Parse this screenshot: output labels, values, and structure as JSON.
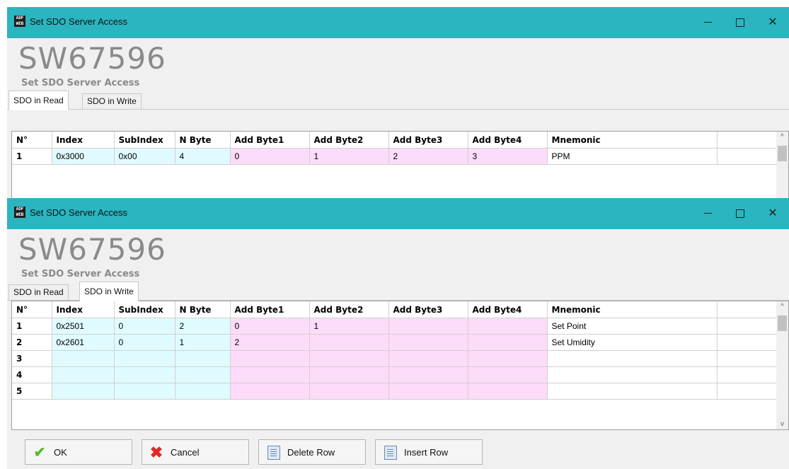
{
  "icon_name": "app-logo-icon",
  "colors": {
    "titlebar": "#2ab5c0",
    "index_cols": "#e0fbff",
    "addbyte_cols": "#fcdcf8"
  },
  "windows": [
    {
      "title": "Set SDO Server Access",
      "code": "SW67596",
      "subtitle": "Set SDO Server Access",
      "tabs": [
        "SDO in Read",
        "SDO in Write"
      ],
      "active_tab": 0,
      "columns": [
        "N°",
        "Index",
        "SubIndex",
        "N Byte",
        "Add Byte1",
        "Add Byte2",
        "Add Byte3",
        "Add Byte4",
        "Mnemonic"
      ],
      "rows": [
        {
          "n": "1",
          "index": "0x3000",
          "subindex": "0x00",
          "nbyte": "4",
          "b1": "0",
          "b2": "1",
          "b3": "2",
          "b4": "3",
          "mnemonic": "PPM"
        }
      ]
    },
    {
      "title": "Set SDO Server Access",
      "code": "SW67596",
      "subtitle": "Set SDO Server Access",
      "tabs": [
        "SDO in Read",
        "SDO in Write"
      ],
      "active_tab": 1,
      "columns": [
        "N°",
        "Index",
        "SubIndex",
        "N Byte",
        "Add Byte1",
        "Add Byte2",
        "Add Byte3",
        "Add Byte4",
        "Mnemonic"
      ],
      "rows": [
        {
          "n": "1",
          "index": "0x2501",
          "subindex": "0",
          "nbyte": "2",
          "b1": "0",
          "b2": "1",
          "b3": "",
          "b4": "",
          "mnemonic": "Set Point"
        },
        {
          "n": "2",
          "index": "0x2601",
          "subindex": "0",
          "nbyte": "1",
          "b1": "2",
          "b2": "",
          "b3": "",
          "b4": "",
          "mnemonic": "Set Umidity"
        },
        {
          "n": "3",
          "index": "",
          "subindex": "",
          "nbyte": "",
          "b1": "",
          "b2": "",
          "b3": "",
          "b4": "",
          "mnemonic": ""
        },
        {
          "n": "4",
          "index": "",
          "subindex": "",
          "nbyte": "",
          "b1": "",
          "b2": "",
          "b3": "",
          "b4": "",
          "mnemonic": ""
        },
        {
          "n": "5",
          "index": "",
          "subindex": "",
          "nbyte": "",
          "b1": "",
          "b2": "",
          "b3": "",
          "b4": "",
          "mnemonic": ""
        }
      ],
      "buttons": {
        "ok": "OK",
        "cancel": "Cancel",
        "delete_row": "Delete Row",
        "insert_row": "Insert Row"
      }
    }
  ]
}
